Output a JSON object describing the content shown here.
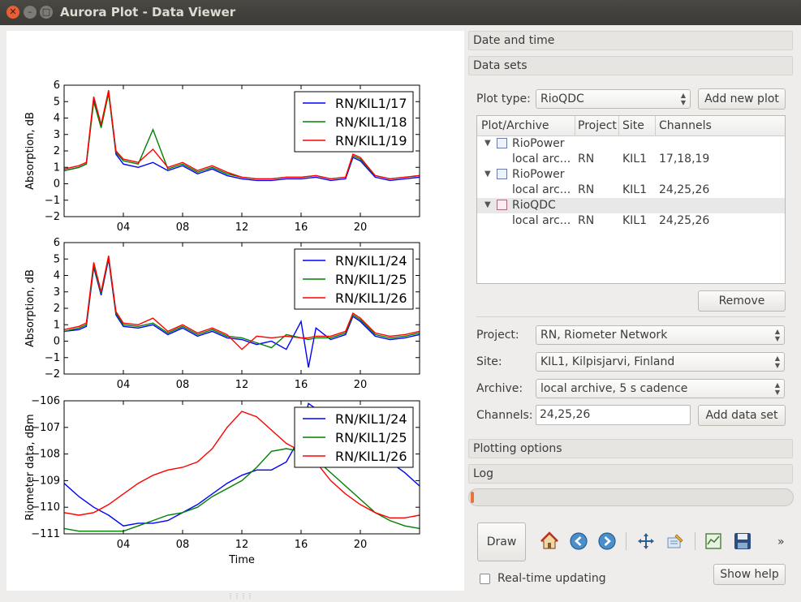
{
  "window": {
    "title": "Aurora Plot - Data Viewer"
  },
  "sections": {
    "date_and_time": "Date and time",
    "data_sets": "Data sets",
    "plotting_options": "Plotting options",
    "log": "Log"
  },
  "plot_type": {
    "label": "Plot type:",
    "value": "RioQDC",
    "add_button": "Add new plot"
  },
  "tree": {
    "headers": [
      "Plot/Archive",
      "Project",
      "Site",
      "Channels"
    ],
    "groups": [
      {
        "plot": "RioPower",
        "archive": "local arc...",
        "project": "RN",
        "site": "KIL1",
        "channels": "17,18,19"
      },
      {
        "plot": "RioPower",
        "archive": "local arc...",
        "project": "RN",
        "site": "KIL1",
        "channels": "24,25,26"
      },
      {
        "plot": "RioQDC",
        "archive": "local arc...",
        "project": "RN",
        "site": "KIL1",
        "channels": "24,25,26"
      }
    ],
    "remove_button": "Remove"
  },
  "dataset_form": {
    "project_label": "Project:",
    "project_value": "RN, Riometer Network",
    "site_label": "Site:",
    "site_value": "KIL1, Kilpisjarvi, Finland",
    "archive_label": "Archive:",
    "archive_value": "local archive, 5 s cadence",
    "channels_label": "Channels:",
    "channels_value": "24,25,26",
    "add_button": "Add data set"
  },
  "progress": {
    "fraction": 0.01
  },
  "toolbar": {
    "draw_label": "Draw",
    "icons": [
      "home-icon",
      "back-icon",
      "forward-icon",
      "pan-icon",
      "zoom-icon",
      "subplots-icon",
      "save-icon"
    ],
    "overflow": "»",
    "realtime_label": "Real-time updating",
    "realtime_checked": false,
    "help_button": "Show help"
  },
  "colors": {
    "blue": "#0000ff",
    "green": "#008000",
    "red": "#ff0000",
    "orange_accent": "#e8743b"
  },
  "chart_data": [
    {
      "type": "line",
      "ylabel": "Absorption, dB",
      "ylim": [
        -2,
        6
      ],
      "yticks": [
        -2,
        -1,
        0,
        1,
        2,
        3,
        4,
        5,
        6
      ],
      "xlim": [
        0,
        24
      ],
      "xticks": [
        "04",
        "08",
        "12",
        "16",
        "20"
      ],
      "xtick_values": [
        4,
        8,
        12,
        16,
        20
      ],
      "legend_position": "top-right",
      "x": [
        0,
        1,
        1.5,
        2,
        2.5,
        3,
        3.5,
        4,
        5,
        6,
        7,
        8,
        9,
        10,
        11,
        12,
        13,
        14,
        15,
        16,
        17,
        18,
        19,
        19.5,
        20,
        21,
        22,
        23,
        24
      ],
      "series": [
        {
          "name": "RN/KIL1/17",
          "color": "#0000ff",
          "values": [
            0.8,
            1.0,
            1.2,
            5.2,
            3.5,
            5.6,
            1.8,
            1.2,
            1.0,
            1.3,
            0.8,
            1.1,
            0.6,
            0.9,
            0.5,
            0.3,
            0.2,
            0.2,
            0.3,
            0.3,
            0.4,
            0.2,
            0.3,
            1.6,
            1.4,
            0.4,
            0.2,
            0.3,
            0.4
          ]
        },
        {
          "name": "RN/KIL1/18",
          "color": "#008000",
          "values": [
            0.8,
            1.0,
            1.2,
            5.0,
            3.4,
            5.5,
            1.9,
            1.4,
            1.2,
            3.3,
            0.9,
            1.2,
            0.7,
            1.0,
            0.6,
            0.4,
            0.3,
            0.3,
            0.4,
            0.4,
            0.5,
            0.3,
            0.4,
            1.7,
            1.5,
            0.5,
            0.3,
            0.4,
            0.5
          ]
        },
        {
          "name": "RN/KIL1/19",
          "color": "#ff0000",
          "values": [
            0.9,
            1.1,
            1.3,
            5.3,
            3.6,
            5.7,
            2.0,
            1.5,
            1.3,
            2.1,
            1.0,
            1.3,
            0.8,
            1.1,
            0.7,
            0.4,
            0.3,
            0.3,
            0.4,
            0.4,
            0.5,
            0.3,
            0.4,
            1.8,
            1.6,
            0.5,
            0.3,
            0.4,
            0.5
          ]
        }
      ]
    },
    {
      "type": "line",
      "ylabel": "Absorption, dB",
      "ylim": [
        -2,
        6
      ],
      "yticks": [
        -2,
        -1,
        0,
        1,
        2,
        3,
        4,
        5,
        6
      ],
      "xlim": [
        0,
        24
      ],
      "xticks": [
        "04",
        "08",
        "12",
        "16",
        "20"
      ],
      "xtick_values": [
        4,
        8,
        12,
        16,
        20
      ],
      "legend_position": "top-right",
      "x": [
        0,
        1,
        1.5,
        2,
        2.5,
        3,
        3.5,
        4,
        5,
        6,
        7,
        8,
        9,
        10,
        11,
        12,
        13,
        14,
        15,
        16,
        16.5,
        17,
        18,
        19,
        19.5,
        20,
        21,
        22,
        23,
        24
      ],
      "series": [
        {
          "name": "RN/KIL1/24",
          "color": "#0000ff",
          "values": [
            0.6,
            0.7,
            0.9,
            4.5,
            2.8,
            5.0,
            1.6,
            0.9,
            0.8,
            1.0,
            0.4,
            0.8,
            0.3,
            0.6,
            0.2,
            0.1,
            -0.2,
            0.0,
            -0.5,
            1.2,
            -1.6,
            0.8,
            0.1,
            0.4,
            1.5,
            1.2,
            0.3,
            0.1,
            0.2,
            0.4
          ]
        },
        {
          "name": "RN/KIL1/25",
          "color": "#008000",
          "values": [
            0.6,
            0.8,
            1.0,
            4.6,
            2.9,
            5.1,
            1.7,
            1.0,
            0.9,
            1.1,
            0.5,
            0.9,
            0.4,
            0.7,
            0.3,
            0.2,
            -0.1,
            -0.4,
            0.4,
            0.2,
            0.1,
            0.2,
            0.2,
            0.5,
            1.6,
            1.3,
            0.4,
            0.2,
            0.3,
            0.5
          ]
        },
        {
          "name": "RN/KIL1/26",
          "color": "#ff0000",
          "values": [
            0.7,
            0.9,
            1.1,
            4.8,
            3.0,
            5.2,
            1.8,
            1.1,
            1.0,
            1.4,
            0.6,
            1.0,
            0.5,
            0.8,
            0.4,
            -0.5,
            0.3,
            0.2,
            0.3,
            0.2,
            0.2,
            0.3,
            0.3,
            0.6,
            1.7,
            1.4,
            0.5,
            0.3,
            0.4,
            0.6
          ]
        }
      ]
    },
    {
      "type": "line",
      "ylabel": "Riometer data, dBm",
      "xlabel": "Time",
      "ylim": [
        -111,
        -106
      ],
      "yticks": [
        -111,
        -110,
        -109,
        -108,
        -107,
        -106
      ],
      "xlim": [
        0,
        24
      ],
      "xticks": [
        "04",
        "08",
        "12",
        "16",
        "20"
      ],
      "xtick_values": [
        4,
        8,
        12,
        16,
        20
      ],
      "legend_position": "top-right",
      "x": [
        0,
        1,
        2,
        3,
        4,
        5,
        6,
        7,
        8,
        9,
        10,
        11,
        12,
        13,
        14,
        15,
        16,
        16.5,
        17,
        18,
        19,
        20,
        21,
        22,
        23,
        24
      ],
      "series": [
        {
          "name": "RN/KIL1/24",
          "color": "#0000ff",
          "values": [
            -109.1,
            -109.6,
            -110.0,
            -110.3,
            -110.7,
            -110.6,
            -110.6,
            -110.5,
            -110.2,
            -109.9,
            -109.5,
            -109.1,
            -108.8,
            -108.6,
            -108.6,
            -108.3,
            -107.3,
            -106.1,
            -106.3,
            -107.2,
            -107.8,
            -108.1,
            -108.2,
            -108.3,
            -108.7,
            -109.2
          ]
        },
        {
          "name": "RN/KIL1/25",
          "color": "#008000",
          "values": [
            -110.8,
            -110.9,
            -110.9,
            -110.9,
            -110.9,
            -110.7,
            -110.5,
            -110.3,
            -110.2,
            -110.0,
            -109.6,
            -109.3,
            -109.0,
            -108.5,
            -107.9,
            -107.8,
            -107.9,
            -108.0,
            -108.2,
            -108.7,
            -109.2,
            -109.7,
            -110.2,
            -110.5,
            -110.7,
            -110.8
          ]
        },
        {
          "name": "RN/KIL1/26",
          "color": "#ff0000",
          "values": [
            -110.2,
            -110.3,
            -110.2,
            -109.9,
            -109.5,
            -109.1,
            -108.8,
            -108.6,
            -108.5,
            -108.3,
            -107.8,
            -107.0,
            -106.4,
            -106.6,
            -107.1,
            -107.6,
            -107.9,
            -108.1,
            -108.3,
            -109.0,
            -109.5,
            -109.9,
            -110.2,
            -110.4,
            -110.4,
            -110.3
          ]
        }
      ]
    }
  ]
}
